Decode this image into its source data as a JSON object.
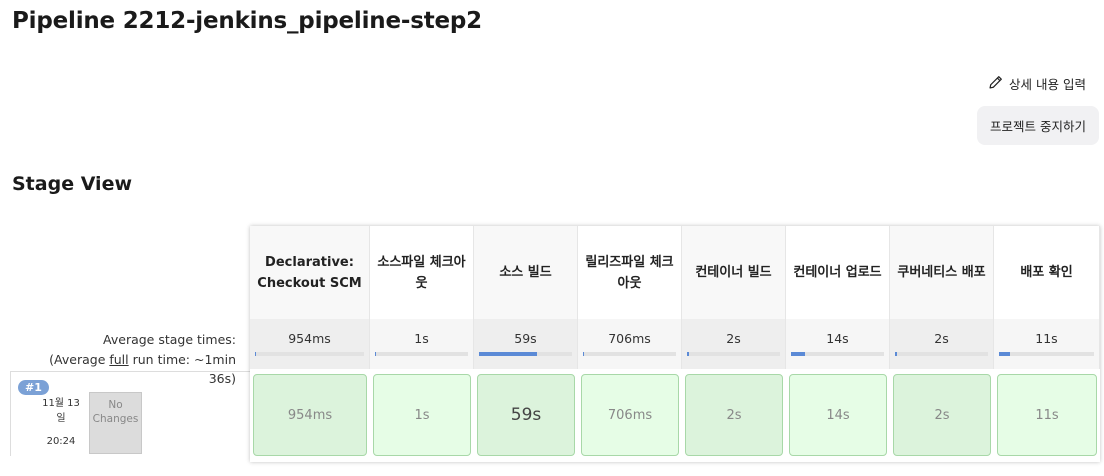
{
  "page": {
    "title": "Pipeline 2212-jenkins_pipeline-step2",
    "edit_description": "상세 내용 입력",
    "disable_project": "프로젝트 중지하기",
    "stage_view_title": "Stage View"
  },
  "summary": {
    "avg_stage_times": "Average stage times:",
    "avg_run_prefix": "(Average ",
    "avg_run_link": "full",
    "avg_run_suffix": " run time: ~1min",
    "avg_run_tail": "36s)"
  },
  "build": {
    "number": "#1",
    "date_line1": "11월 13",
    "date_line2": "일",
    "time": "20:24",
    "changes": "No Changes"
  },
  "stages": [
    {
      "name": "Declarative: Checkout SCM",
      "avg": "954ms",
      "run": "954ms",
      "bar_fraction": 0.01
    },
    {
      "name": "소스파일 체크아웃",
      "avg": "1s",
      "run": "1s",
      "bar_fraction": 0.01
    },
    {
      "name": "소스 빌드",
      "avg": "59s",
      "run": "59s",
      "bar_fraction": 0.62
    },
    {
      "name": "릴리즈파일 체크아웃",
      "avg": "706ms",
      "run": "706ms",
      "bar_fraction": 0.01
    },
    {
      "name": "컨테이너 빌드",
      "avg": "2s",
      "run": "2s",
      "bar_fraction": 0.02
    },
    {
      "name": "컨테이너 업로드",
      "avg": "14s",
      "run": "14s",
      "bar_fraction": 0.15
    },
    {
      "name": "쿠버네티스 배포",
      "avg": "2s",
      "run": "2s",
      "bar_fraction": 0.02
    },
    {
      "name": "배포 확인",
      "avg": "11s",
      "run": "11s",
      "bar_fraction": 0.12
    }
  ],
  "colors": {
    "success_cell": "#dcf3dc",
    "success_cell_alt": "#e6fde6",
    "bar_fill": "#5b8ad6",
    "badge": "#7ba1d6"
  }
}
